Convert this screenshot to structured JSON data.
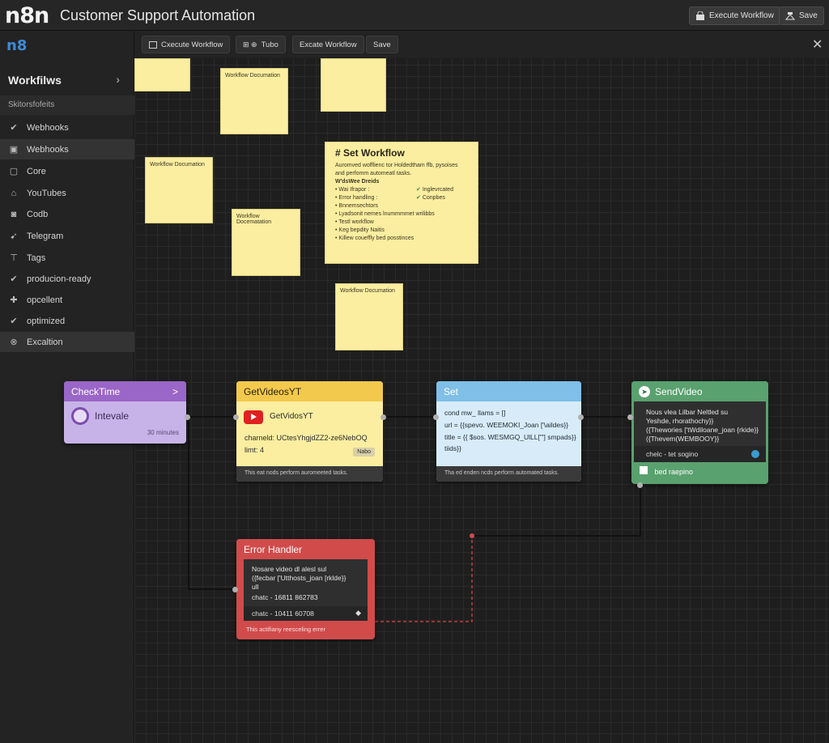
{
  "header": {
    "logo": "n8n",
    "title": "Customer Support Automation",
    "execute_label": "Execute Workflow",
    "save_label": "Save"
  },
  "sidebar": {
    "logo": "n8",
    "heading": "Workfilws",
    "subheading": "Skitorsfofeits",
    "items": [
      {
        "label": "Webhooks",
        "icon": "check-icon"
      },
      {
        "label": "Webhooks",
        "icon": "box-icon"
      },
      {
        "label": "Core",
        "icon": "core-icon"
      },
      {
        "label": "YouTubes",
        "icon": "home-icon"
      },
      {
        "label": "Codb",
        "icon": "code-icon"
      },
      {
        "label": "Telegram",
        "icon": "telegram-icon"
      },
      {
        "label": "Tags",
        "icon": "tag-icon"
      },
      {
        "label": "producion-ready",
        "icon": "check-icon"
      },
      {
        "label": "opcellent",
        "icon": "plus-icon"
      },
      {
        "label": "optimized",
        "icon": "check-icon"
      },
      {
        "label": "Excaltion",
        "icon": "x-circle-icon"
      }
    ]
  },
  "toolbar": {
    "execute_label": "Cxecute Workflow",
    "tube_label": "Tubo",
    "execute2_label": "Excate Workflow",
    "save_label": "Save"
  },
  "stickies": {
    "small_label": "Workflow Documation",
    "small_label2": "Workflow Documation",
    "small_label3": "Workflow Documation",
    "small_label4": "Workflow Docematation",
    "main": {
      "title": "# Set Workflow",
      "intro1": "Auromved wofflienc tor Holdedtham  ffb, pysoises",
      "intro2": "and perfomm automeatl tasks.",
      "subtitle": "W'dsWee Dreids",
      "lines": [
        "Wai Ifrapor :",
        "Error  handling :",
        "Bnnemsechtors",
        "Lyadsonit nemes  lnummmmet wrilibbs",
        "Testl workflow",
        "Keg bepdity Naitis",
        "Killew coueffly bed posstinces"
      ],
      "checks": [
        "Inglevrcated",
        "Conpbes"
      ]
    }
  },
  "nodes": {
    "checktime": {
      "title": "CheckTime",
      "chevron": ">",
      "label": "Intevale",
      "interval": "30 minutes"
    },
    "getvideos": {
      "title": "GetVideosYT",
      "sub": "GetVidosYT",
      "line1": "charneld: UCtesYhgjdZZ2-ze6NebOQ",
      "line2": "limt: 4",
      "tag": "Nabo",
      "footer": "This eat nods perform auromeeted tasks."
    },
    "set": {
      "title": "Set",
      "line1": "cond mw_ llams = []",
      "line2": "url  = {{spevo. WEEMOKI_Joan ['\\aildes}}",
      "line3": "title  = {{ $sos. WESMGQ_UlLL['\"] smpads}}",
      "line4": "tiids}}",
      "footer": "Tha ed enden ncds perform automated tasks."
    },
    "sendvideo": {
      "title": "SendVideo",
      "body1": "Nous vlea  Lilbar Neltled su",
      "body2": "Yeshde, rhorathochy}}",
      "body3": "({Thewories ['tWdiloane_joan {rkide}}",
      "body4": "({Thevem(WEMBOOY}}",
      "chat": "chelc  -  tet sogino",
      "footer": "bed raepino"
    },
    "error": {
      "title": "Error Handler",
      "body1": "Nosare video dl alesl sul",
      "body2": "({fecbar ['Utthosts_joan [rklde}}",
      "body3": "ull",
      "chat1": "chatc  -  16811 862783",
      "chat2": "chatc  -  10411 60708",
      "footer": "This actifiany reesceling errer"
    }
  },
  "colors": {
    "purple": "#9a66c7",
    "yellow": "#f2c94c",
    "blue": "#7fbfe8",
    "green": "#59a16e",
    "red": "#d14b4b"
  }
}
